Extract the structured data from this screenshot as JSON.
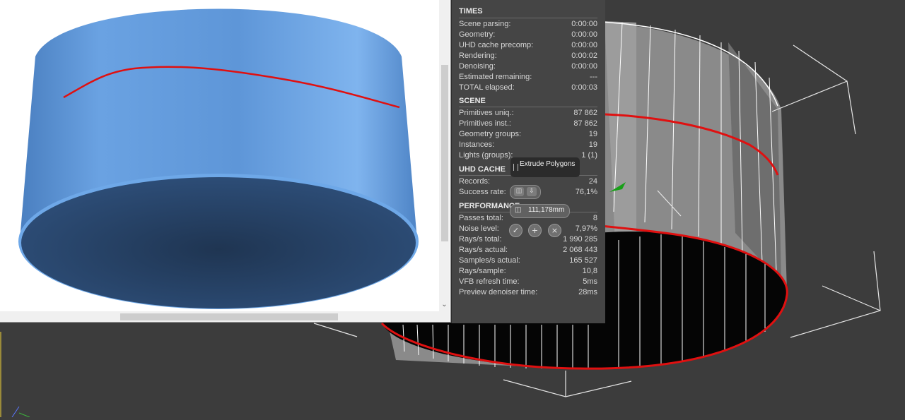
{
  "stats": {
    "sections": [
      {
        "title": "TIMES",
        "rows": [
          {
            "label": "Scene parsing:",
            "value": "0:00:00"
          },
          {
            "label": "Geometry:",
            "value": "0:00:00"
          },
          {
            "label": "UHD cache precomp:",
            "value": "0:00:00"
          },
          {
            "label": "Rendering:",
            "value": "0:00:02"
          },
          {
            "label": "Denoising:",
            "value": "0:00:00"
          },
          {
            "label": "Estimated remaining:",
            "value": "---"
          },
          {
            "label": "TOTAL elapsed:",
            "value": "0:00:03"
          }
        ]
      },
      {
        "title": "SCENE",
        "rows": [
          {
            "label": "Primitives uniq.:",
            "value": "87 862"
          },
          {
            "label": "Primitives inst.:",
            "value": "87 862"
          },
          {
            "label": "Geometry groups:",
            "value": "19"
          },
          {
            "label": "Instances:",
            "value": "19"
          },
          {
            "label": "Lights (groups):",
            "value": "1 (1)"
          }
        ]
      },
      {
        "title": "UHD CACHE",
        "rows": [
          {
            "label": "Records:",
            "value": "24"
          },
          {
            "label": "Success rate:",
            "value": "76,1%"
          }
        ]
      },
      {
        "title": "PERFORMANCE",
        "rows": [
          {
            "label": "Passes total:",
            "value": "8"
          },
          {
            "label": "Noise level:",
            "value": "7,97%"
          },
          {
            "label": "Rays/s total:",
            "value": "1 990 285"
          },
          {
            "label": "Rays/s actual:",
            "value": "2 068 443"
          },
          {
            "label": "Samples/s actual:",
            "value": "165 527"
          },
          {
            "label": "Rays/sample:",
            "value": "10,8"
          },
          {
            "label": "VFB refresh time:",
            "value": "5ms"
          },
          {
            "label": "Preview denoiser time:",
            "value": "28ms"
          }
        ]
      }
    ]
  },
  "caddy": {
    "tooltip": "Extrude Polygons",
    "height_value": "111,178mm",
    "mode_icons": [
      "extrude-group-icon",
      "extrude-local-normal-icon"
    ],
    "actions": [
      "ok-icon",
      "apply-icon",
      "cancel-icon"
    ]
  },
  "colors": {
    "viewport_bg": "#3c3c3c",
    "panel_bg": "#454545",
    "render_blue": "#5b93d6",
    "selection_red": "#e01010",
    "wire": "#ffffff"
  }
}
